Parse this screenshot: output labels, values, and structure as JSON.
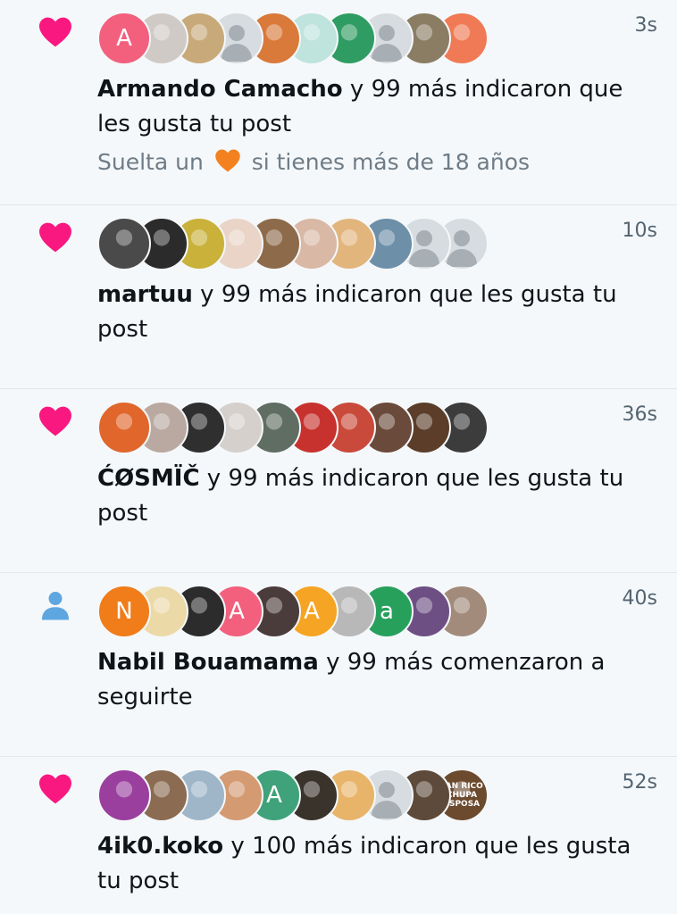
{
  "colors": {
    "like": "#f91880",
    "follow": "#5ea6e0",
    "text": "#0f1419",
    "secondary": "#536471",
    "background": "#f5f8fa"
  },
  "notifications": [
    {
      "type": "like",
      "icon": "heart-icon",
      "time": "3s",
      "actor": "Armando Camacho",
      "action": " y 99 más indicaron que les gusta tu post",
      "preview": {
        "before": "Suelta un ",
        "emoji": "orange-heart",
        "after": " si tienes más de 18 años"
      },
      "avatars": [
        {
          "kind": "letter",
          "letter": "A",
          "color": "#f2607e"
        },
        {
          "kind": "photo",
          "color": "#cfcac6"
        },
        {
          "kind": "photo",
          "color": "#c8aa7a"
        },
        {
          "kind": "default"
        },
        {
          "kind": "photo",
          "color": "#d9793a"
        },
        {
          "kind": "photo",
          "color": "#bfe3dd"
        },
        {
          "kind": "photo",
          "color": "#2f9d63"
        },
        {
          "kind": "default"
        },
        {
          "kind": "photo",
          "color": "#8a7d64"
        },
        {
          "kind": "photo",
          "color": "#f07a55"
        }
      ]
    },
    {
      "type": "like",
      "icon": "heart-icon",
      "time": "10s",
      "actor": "martuu",
      "action": " y 99 más indicaron que les gusta tu post",
      "avatars": [
        {
          "kind": "photo",
          "color": "#4a4a4a"
        },
        {
          "kind": "photo",
          "color": "#2b2b2b"
        },
        {
          "kind": "photo",
          "color": "#c9b13a"
        },
        {
          "kind": "photo",
          "color": "#e9d4c7"
        },
        {
          "kind": "photo",
          "color": "#8d6a4a"
        },
        {
          "kind": "photo",
          "color": "#d9b8a5"
        },
        {
          "kind": "photo",
          "color": "#e2b57d"
        },
        {
          "kind": "photo",
          "color": "#6d8fa8"
        },
        {
          "kind": "default"
        },
        {
          "kind": "default"
        }
      ]
    },
    {
      "type": "like",
      "icon": "heart-icon",
      "time": "36s",
      "actor": "ĆØSMÏČ",
      "action": " y 99 más indicaron que les gusta tu post",
      "avatars": [
        {
          "kind": "photo",
          "color": "#e0662c"
        },
        {
          "kind": "photo",
          "color": "#b9a9a1"
        },
        {
          "kind": "photo",
          "color": "#2f2f2f"
        },
        {
          "kind": "photo",
          "color": "#d5d0cc"
        },
        {
          "kind": "photo",
          "color": "#5f6d63"
        },
        {
          "kind": "photo",
          "color": "#c7322e"
        },
        {
          "kind": "photo",
          "color": "#c94a3b"
        },
        {
          "kind": "photo",
          "color": "#6a4a3a"
        },
        {
          "kind": "photo",
          "color": "#5b3d2a"
        },
        {
          "kind": "photo",
          "color": "#3c3c3c"
        }
      ]
    },
    {
      "type": "follow",
      "icon": "person-icon",
      "time": "40s",
      "actor": "Nabil Bouamama",
      "action": " y 99 más comenzaron a seguirte",
      "avatars": [
        {
          "kind": "letter",
          "letter": "N",
          "color": "#f07c1a"
        },
        {
          "kind": "photo",
          "color": "#ecd9a8"
        },
        {
          "kind": "photo",
          "color": "#2c2c2c"
        },
        {
          "kind": "letter",
          "letter": "A",
          "color": "#f2607e"
        },
        {
          "kind": "photo",
          "color": "#4b3c3c"
        },
        {
          "kind": "letter",
          "letter": "A",
          "color": "#f5a523"
        },
        {
          "kind": "photo",
          "color": "#b8b8b8"
        },
        {
          "kind": "letter",
          "letter": "a",
          "color": "#27a05c"
        },
        {
          "kind": "photo",
          "color": "#6d4f84"
        },
        {
          "kind": "photo",
          "color": "#a28b7a"
        }
      ]
    },
    {
      "type": "like",
      "icon": "heart-icon",
      "time": "52s",
      "actor": "4ik0.koko",
      "action": " y 100 más indicaron que les gusta tu post",
      "avatars": [
        {
          "kind": "photo",
          "color": "#9a3f9e"
        },
        {
          "kind": "photo",
          "color": "#8b6b52"
        },
        {
          "kind": "photo",
          "color": "#9fb6c9"
        },
        {
          "kind": "photo",
          "color": "#d49a72"
        },
        {
          "kind": "letter",
          "letter": "A",
          "color": "#3fa27a"
        },
        {
          "kind": "photo",
          "color": "#3a332c"
        },
        {
          "kind": "photo",
          "color": "#e8b46a"
        },
        {
          "kind": "default"
        },
        {
          "kind": "photo",
          "color": "#5d4a3a"
        },
        {
          "kind": "photo",
          "color": "#6b4a2e",
          "label": "TAN RICO CHUPA ESPOSA"
        }
      ]
    }
  ]
}
